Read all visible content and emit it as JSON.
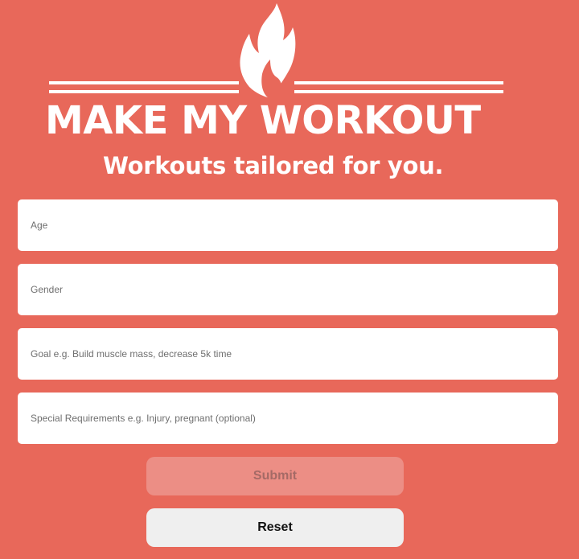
{
  "logo": {
    "title": "MAKE MY WORKOUT",
    "tagline": "Workouts tailored for you.",
    "icon": "flame-icon"
  },
  "form": {
    "fields": [
      {
        "name": "age",
        "placeholder": "Age",
        "value": ""
      },
      {
        "name": "gender",
        "placeholder": "Gender",
        "value": ""
      },
      {
        "name": "goal",
        "placeholder": "Goal e.g. Build muscle mass, decrease 5k time",
        "value": ""
      },
      {
        "name": "special_requirements",
        "placeholder": "Special Requirements e.g. Injury, pregnant (optional)",
        "value": ""
      }
    ],
    "submit_label": "Submit",
    "reset_label": "Reset"
  },
  "colors": {
    "background": "#e8685a",
    "submit_bg": "#ec8e85",
    "reset_bg": "#efefef"
  }
}
